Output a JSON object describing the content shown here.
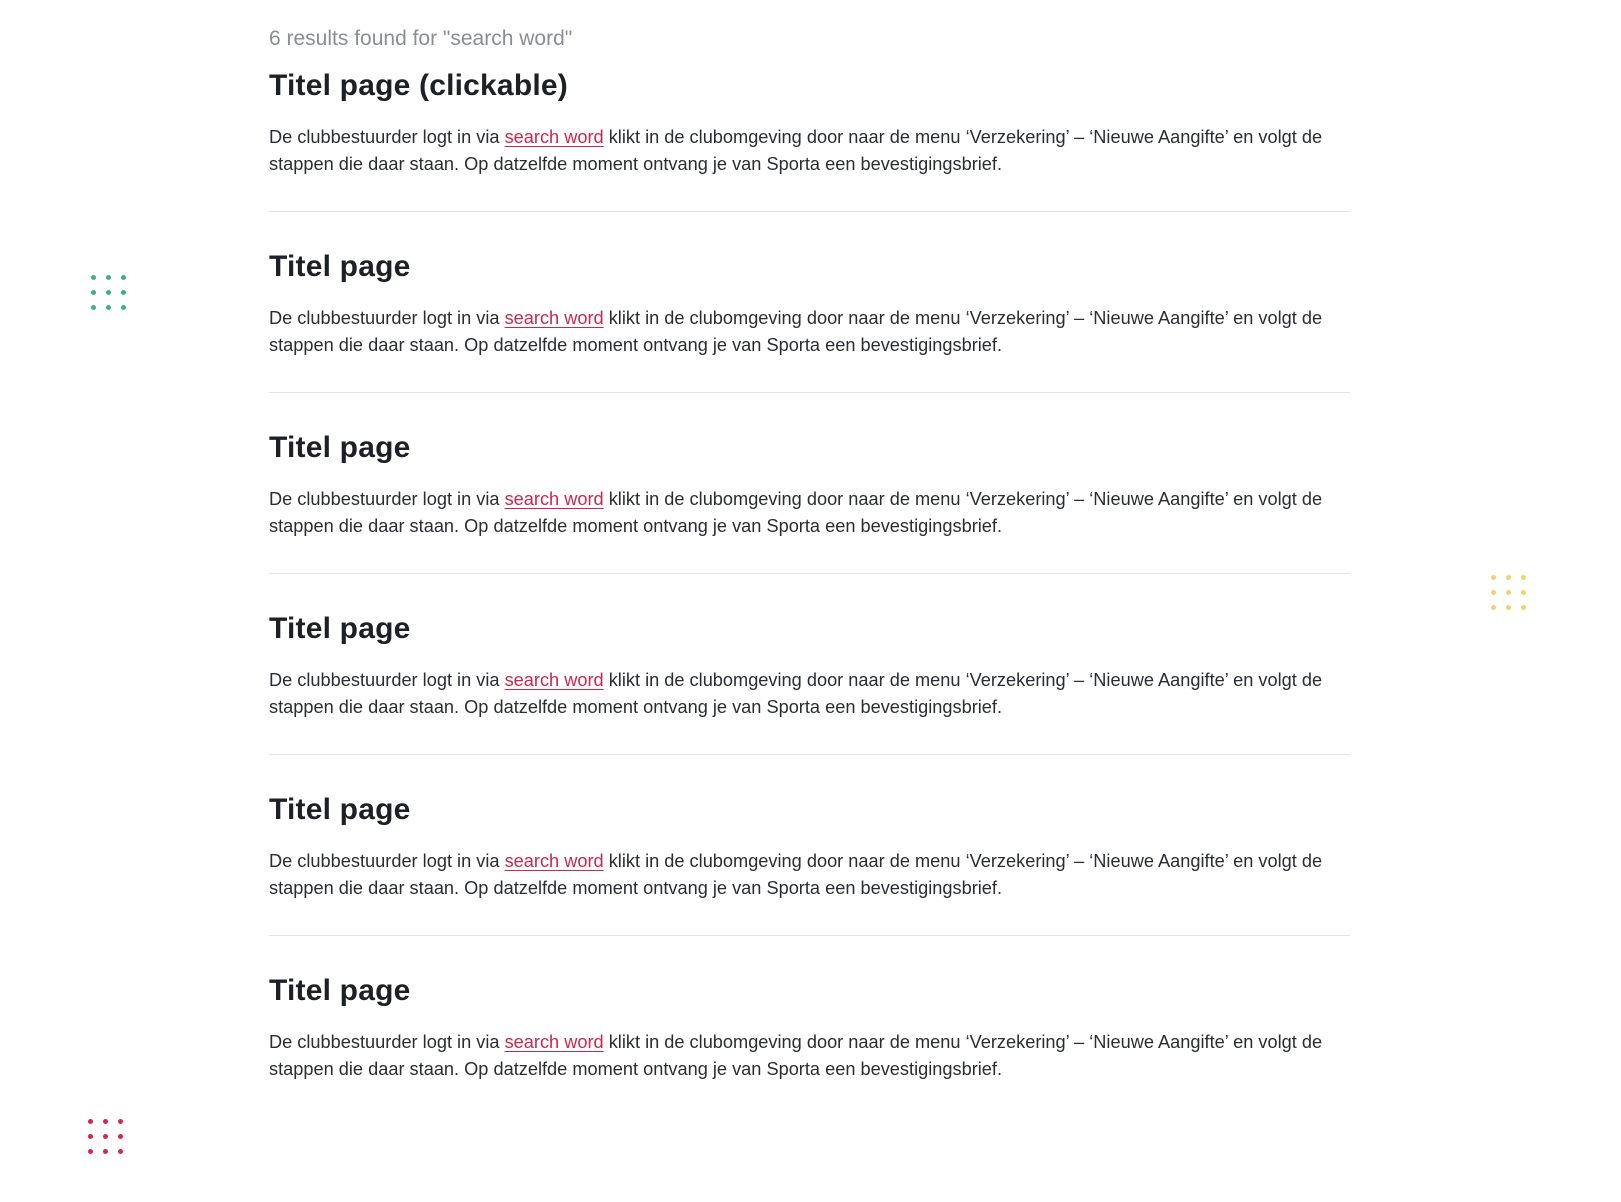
{
  "results_summary": "6 results found for \"search word\"",
  "results": [
    {
      "title": "Titel page (clickable)",
      "text_before": "De clubbestuurder logt in via ",
      "link": "search word",
      "text_after": " klikt in de clubomgeving door naar de menu ‘Verzekering’ – ‘Nieuwe Aangifte’ en volgt de stappen die daar staan. Op datzelfde moment ontvang je van Sporta een bevestigingsbrief."
    },
    {
      "title": "Titel page",
      "text_before": "De clubbestuurder logt in via ",
      "link": "search word",
      "text_after": " klikt in de clubomgeving door naar de menu ‘Verzekering’ – ‘Nieuwe Aangifte’ en volgt de stappen die daar staan. Op datzelfde moment ontvang je van Sporta een bevestigingsbrief."
    },
    {
      "title": "Titel page",
      "text_before": "De clubbestuurder logt in via ",
      "link": "search word",
      "text_after": " klikt in de clubomgeving door naar de menu ‘Verzekering’ – ‘Nieuwe Aangifte’ en volgt de stappen die daar staan. Op datzelfde moment ontvang je van Sporta een bevestigingsbrief."
    },
    {
      "title": "Titel page",
      "text_before": "De clubbestuurder logt in via ",
      "link": "search word",
      "text_after": " klikt in de clubomgeving door naar de menu ‘Verzekering’ – ‘Nieuwe Aangifte’ en volgt de stappen die daar staan. Op datzelfde moment ontvang je van Sporta een bevestigingsbrief."
    },
    {
      "title": "Titel page",
      "text_before": "De clubbestuurder logt in via ",
      "link": "search word",
      "text_after": " klikt in de clubomgeving door naar de menu ‘Verzekering’ – ‘Nieuwe Aangifte’ en volgt de stappen die daar staan. Op datzelfde moment ontvang je van Sporta een bevestigingsbrief."
    },
    {
      "title": "Titel page",
      "text_before": "De clubbestuurder logt in via ",
      "link": "search word",
      "text_after": " klikt in de clubomgeving door naar de menu ‘Verzekering’ – ‘Nieuwe Aangifte’ en volgt de stappen die daar staan. Op datzelfde moment ontvang je van Sporta een bevestigingsbrief."
    }
  ],
  "colors": {
    "link": "#c8284e",
    "heading": "#1d2026",
    "muted": "#8a8e94",
    "divider": "#e3e4e6",
    "dots_green": "#3fae8e",
    "dots_yellow": "#f2d36b",
    "dots_red": "#d4264f"
  },
  "decorations": [
    "dot-grid-green",
    "dot-grid-yellow",
    "dot-grid-red"
  ]
}
